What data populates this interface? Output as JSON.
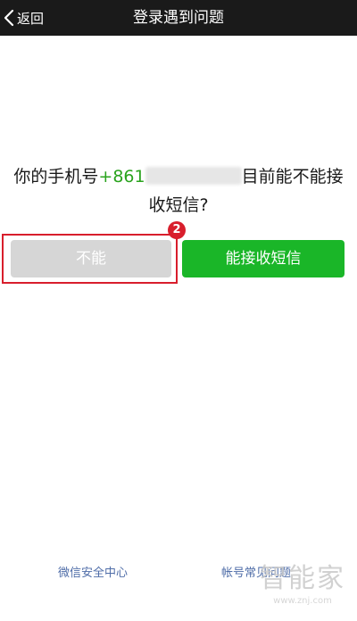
{
  "nav": {
    "back_label": "返回",
    "title": "登录遇到问题"
  },
  "question": {
    "prefix": "你的手机号",
    "phone_visible": "+861",
    "suffix_line1": "目前能不能接",
    "line2": "收短信?"
  },
  "buttons": {
    "no_label": "不能",
    "yes_label": "能接收短信"
  },
  "annotation": {
    "step_number": "2"
  },
  "footer": {
    "left_link": "微信安全中心",
    "right_link": "帐号常见问题"
  },
  "watermark": {
    "text": "智能家",
    "url": "www.znj.com"
  },
  "colors": {
    "navbar": "#1a1a1a",
    "phone_green": "#2aa31e",
    "primary_button": "#1ab628",
    "disabled_button": "#d6d6d6",
    "highlight_red": "#d81e2c",
    "link_blue": "#4f6da8"
  }
}
